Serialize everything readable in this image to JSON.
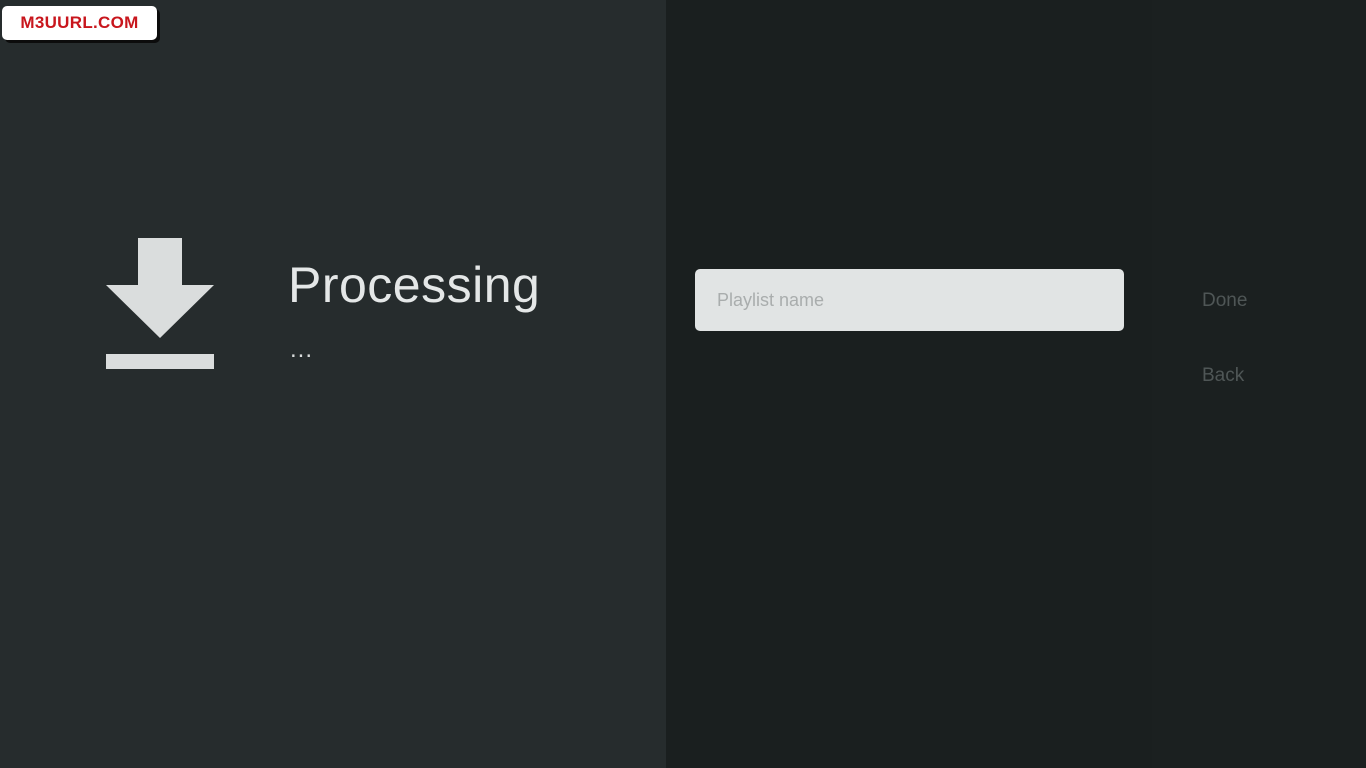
{
  "watermark": {
    "text": "M3UURL.COM",
    "color": "#c8161d"
  },
  "guidance": {
    "icon": "download-icon",
    "title": "Processing",
    "subtitle": "..."
  },
  "form": {
    "playlist_name": {
      "value": "",
      "placeholder": "Playlist name"
    }
  },
  "actions": {
    "done_label": "Done",
    "back_label": "Back"
  },
  "colors": {
    "left_background": "#262c2d",
    "right_background": "#1a1f1f",
    "input_background": "#e1e4e4",
    "action_text": "#4f5656"
  }
}
